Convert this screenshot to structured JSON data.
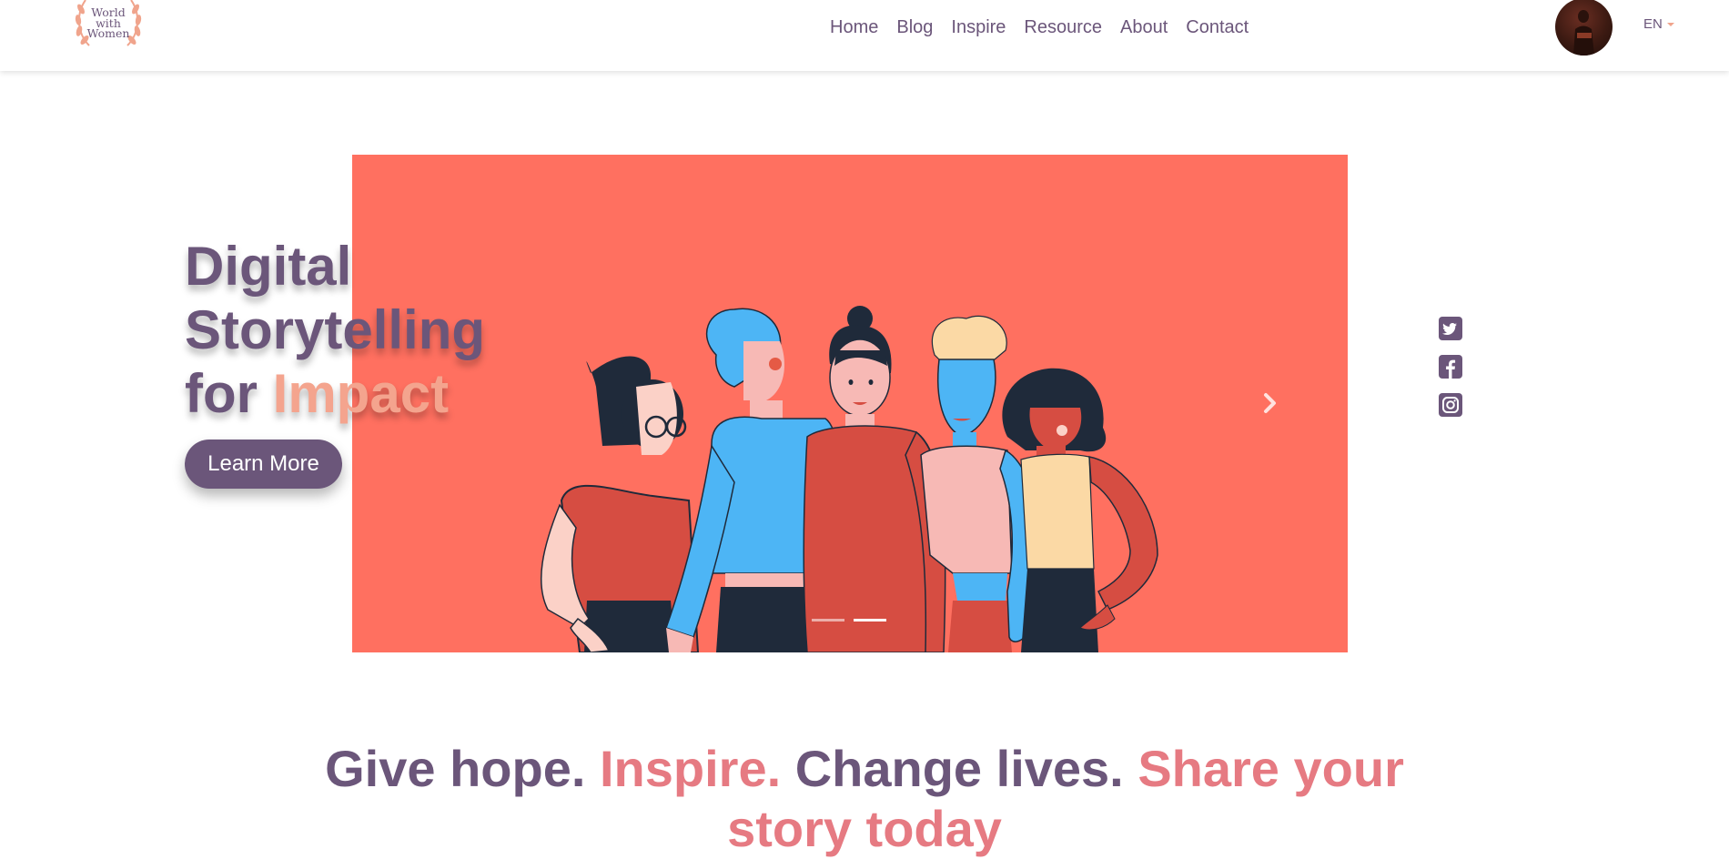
{
  "brand": {
    "logo_text_line1": "World",
    "logo_text_line2": "with",
    "logo_text_line3": "Women"
  },
  "nav": {
    "items": [
      {
        "label": "Home"
      },
      {
        "label": "Blog"
      },
      {
        "label": "Inspire"
      },
      {
        "label": "Resource"
      },
      {
        "label": "About"
      },
      {
        "label": "Contact"
      }
    ]
  },
  "language": {
    "selected": "EN"
  },
  "hero": {
    "title_line1": "Digital",
    "title_line2": "Storytelling",
    "title_line3_prefix": "for",
    "title_line3_accent": "Impact",
    "button_label": "Learn More",
    "slides_count": 2,
    "active_slide": 2
  },
  "social": {
    "icons": [
      "twitter-icon",
      "facebook-icon",
      "instagram-icon"
    ]
  },
  "tagline": {
    "part1": "Give hope.",
    "part2": "Inspire.",
    "part3": "Change lives.",
    "part4": "Share your story today"
  },
  "colors": {
    "primary": "#6b567a",
    "accent_peach": "#f4a48e",
    "accent_pink": "#e67a82",
    "hero_bg": "#ff7060"
  }
}
